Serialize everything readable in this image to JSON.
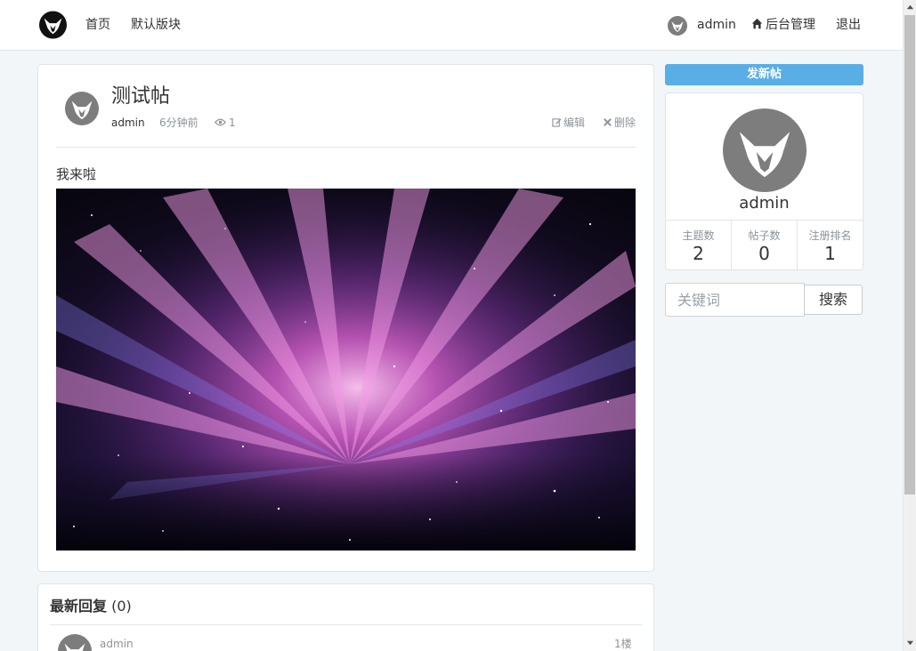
{
  "navbar": {
    "logo_icon": "fox-head-logo-icon",
    "links": [
      {
        "label": "首页"
      },
      {
        "label": "默认版块"
      }
    ],
    "user_name": "admin",
    "admin_icon": "home-icon",
    "admin_label": "后台管理",
    "logout_label": "退出"
  },
  "post": {
    "title": "测试帖",
    "author": "admin",
    "time": "6分钟前",
    "views": "1",
    "edit_label": "编辑",
    "delete_label": "删除",
    "content": "我来啦",
    "image_icon": "aurora-galaxy-image"
  },
  "replies": {
    "heading": "最新回复",
    "count": "(0)",
    "items": [
      {
        "author": "admin",
        "floor": "1楼"
      }
    ]
  },
  "sidebar": {
    "new_post_label": "发新帖",
    "profile": {
      "name": "admin",
      "stats": [
        {
          "label": "主题数",
          "value": "2"
        },
        {
          "label": "帖子数",
          "value": "0"
        },
        {
          "label": "注册排名",
          "value": "1"
        }
      ]
    },
    "search": {
      "placeholder": "关键词",
      "button_label": "搜索"
    }
  },
  "colors": {
    "accent": "#5aaee6",
    "background": "#f3f6f8",
    "muted_text": "#8c9399"
  }
}
